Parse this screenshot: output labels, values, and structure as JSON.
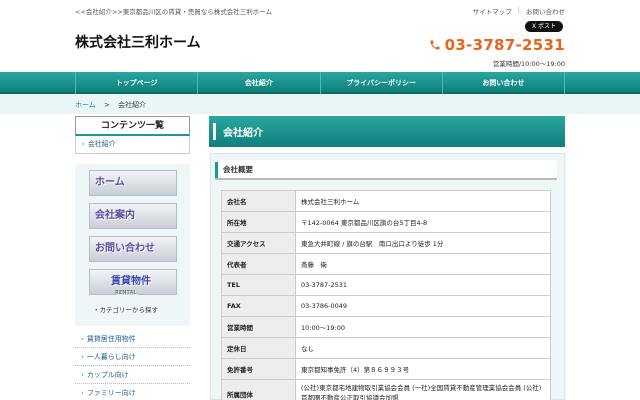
{
  "header": {
    "tagline": "<<会社紹介>>東京都品川区の賃貸・売買なら株式会社三利ホーム",
    "sitemap": "サイトマップ",
    "contact_link": "お問い合わせ",
    "post_button": "X ポスト",
    "company_name": "株式会社三利ホーム",
    "phone": "03-3787-2531",
    "hours": "営業時間/10:00〜19:00"
  },
  "nav": {
    "items": [
      {
        "label": "トップページ"
      },
      {
        "label": "会社紹介"
      },
      {
        "label": "プライバシーポリシー"
      },
      {
        "label": "お問い合わせ"
      }
    ]
  },
  "breadcrumb": {
    "home": "ホーム",
    "sep": ">",
    "current": "会社紹介"
  },
  "sidebar": {
    "contents_title": "コンテンツ一覧",
    "contents_item": "会社紹介",
    "banners": {
      "home": "ホーム",
      "company": "会社案内",
      "contact": "お問い合わせ",
      "rental": "賃貸物件",
      "rental_sub": "RENTAL"
    },
    "category_link": "・カテゴリーから探す",
    "categories": [
      {
        "label": "賃貸居住用物件"
      },
      {
        "label": "一人暮らし向け"
      },
      {
        "label": "カップル向け"
      },
      {
        "label": "ファミリー向け"
      }
    ]
  },
  "main": {
    "page_title": "会社紹介",
    "section_title": "会社概要",
    "rows": [
      {
        "key": "会社名",
        "value": "株式会社三利ホーム"
      },
      {
        "key": "所在地",
        "value": "〒142-0064 東京都品川区旗の台5丁目4-8"
      },
      {
        "key": "交通アクセス",
        "value": "東急大井町線 / 旗の台駅　南口出口より徒歩 1分"
      },
      {
        "key": "代表者",
        "value": "斎藤　衛"
      },
      {
        "key": "TEL",
        "value": "03-3787-2531"
      },
      {
        "key": "FAX",
        "value": "03-3786-0049"
      },
      {
        "key": "営業時間",
        "value": "10:00〜19:00"
      },
      {
        "key": "定休日",
        "value": "なし"
      },
      {
        "key": "免許番号",
        "value": "東京都知事免許（4）第８６９９３号"
      },
      {
        "key": "所属団体",
        "value": "(公社)東京都宅地建物取引業協会会員 (一社)全国賃貸不動産管理業協会会員 (公社)首都圏不動産公正取引協議会加盟"
      }
    ]
  },
  "colors": {
    "accent": "#1a9a95",
    "phone": "#e8641b"
  }
}
